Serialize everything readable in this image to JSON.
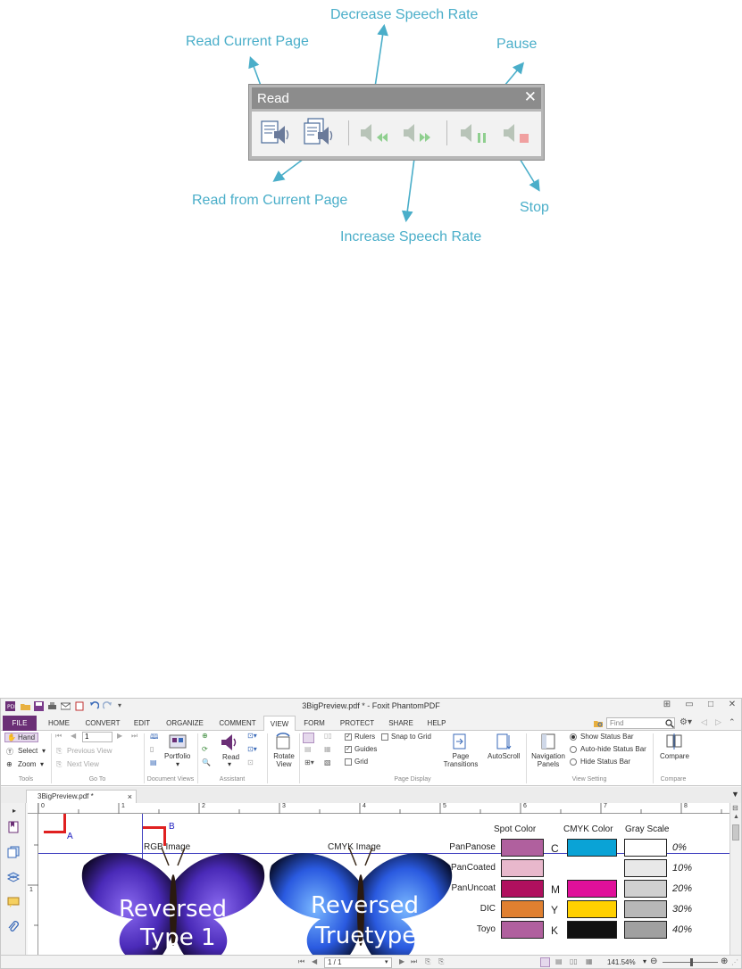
{
  "figure": {
    "callouts": {
      "read_current_page": "Read Current Page",
      "decrease_speech_rate": "Decrease Speech Rate",
      "pause": "Pause",
      "read_from_current_page": "Read from Current Page",
      "stop": "Stop",
      "increase_speech_rate": "Increase Speech Rate"
    },
    "panel": {
      "title": "Read",
      "close": "✕"
    },
    "colors": {
      "callout": "#4aaec9",
      "panel_title_bg": "#8c8c8c"
    }
  },
  "app": {
    "title": "3BigPreview.pdf * - Foxit PhantomPDF",
    "tabs": [
      "FILE",
      "HOME",
      "CONVERT",
      "EDIT",
      "ORGANIZE",
      "COMMENT",
      "VIEW",
      "FORM",
      "PROTECT",
      "SHARE",
      "HELP"
    ],
    "find_placeholder": "Find",
    "ribbon": {
      "tools": {
        "hand": "Hand",
        "select": "Select",
        "zoom": "Zoom",
        "label": "Tools"
      },
      "goto": {
        "page": "1",
        "previous": "Previous View",
        "next": "Next View",
        "label": "Go To"
      },
      "docviews": {
        "portfolio": "Portfolio",
        "label": "Document Views"
      },
      "assistant": {
        "read": "Read",
        "label": "Assistant"
      },
      "rotate": {
        "label": "Rotate View"
      },
      "page_display": {
        "rulers": "Rulers",
        "guides": "Guides",
        "grid": "Grid",
        "snap": "Snap to Grid",
        "transitions": "Page Transitions",
        "autoscroll": "AutoScroll",
        "label": "Page Display"
      },
      "view_setting": {
        "nav": "Navigation Panels",
        "show": "Show Status Bar",
        "autohide": "Auto-hide Status Bar",
        "hide": "Hide Status Bar",
        "label": "View Setting"
      },
      "compare": {
        "btn": "Compare",
        "label": "Compare"
      }
    },
    "doc_tab": {
      "name": "3BigPreview.pdf *",
      "close": "×"
    },
    "ruler_top": [
      "0",
      "1",
      "2",
      "3",
      "4",
      "5",
      "6",
      "7",
      "8"
    ],
    "ruler_left": [
      "1"
    ],
    "page": {
      "guide_a": "A",
      "guide_b": "B",
      "rgb_label": "RGB Image",
      "cmyk_label": "CMYK Image",
      "left_text_1": "Reversed",
      "left_text_2": "Type 1",
      "right_text_1": "Reversed",
      "right_text_2": "Truetype",
      "headers": {
        "spot": "Spot Color",
        "cmyk": "CMYK Color",
        "gray": "Gray Scale"
      },
      "rows": [
        {
          "label": "PanPanose",
          "spot": "#b0609e",
          "letter": "C",
          "cmyk": "#0aa3d6",
          "gray": "#ffffff",
          "pct": "0%"
        },
        {
          "label": "PanCoated",
          "spot": "#e8b8cc",
          "letter": "",
          "cmyk": "",
          "gray": "#e8e8e8",
          "pct": "10%"
        },
        {
          "label": "PanUncoat",
          "spot": "#b0105e",
          "letter": "M",
          "cmyk": "#e0109a",
          "gray": "#d0d0d0",
          "pct": "20%"
        },
        {
          "label": "DIC",
          "spot": "#e08030",
          "letter": "Y",
          "cmyk": "#ffd000",
          "gray": "#b8b8b8",
          "pct": "30%"
        },
        {
          "label": "Toyo",
          "spot": "#b0609e",
          "letter": "K",
          "cmyk": "#111111",
          "gray": "#a0a0a0",
          "pct": "40%"
        }
      ]
    },
    "status": {
      "page": "1 / 1",
      "zoom": "141.54%"
    }
  }
}
